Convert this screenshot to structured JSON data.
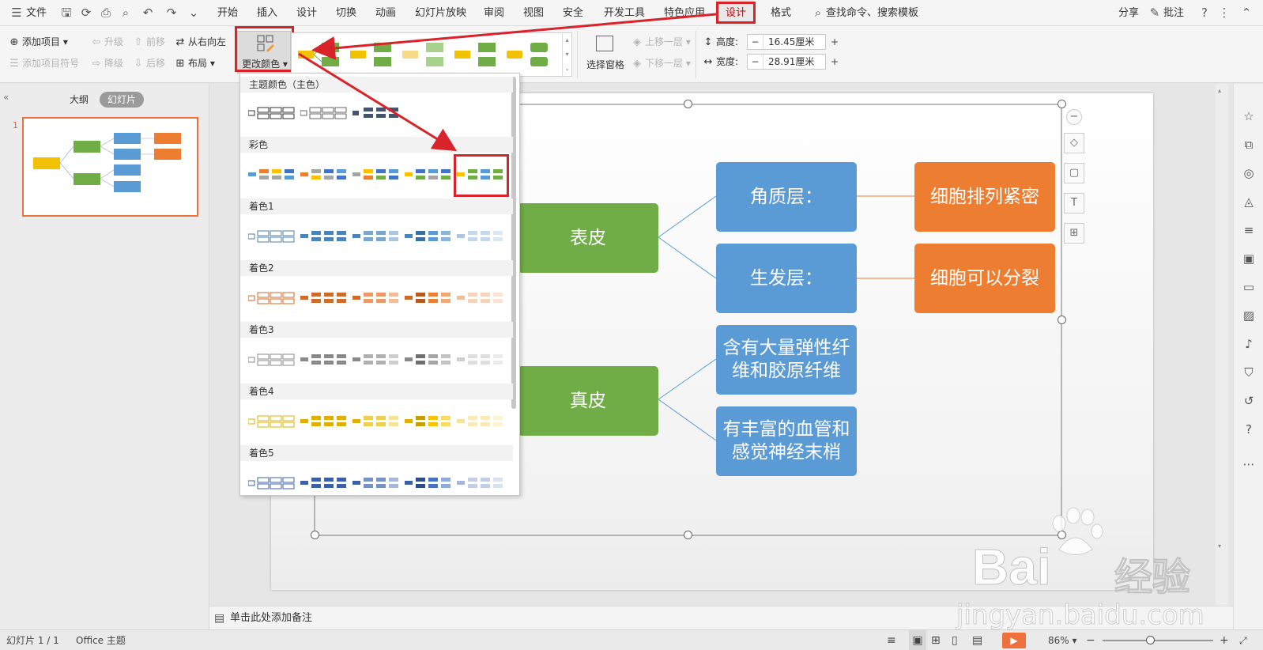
{
  "menubar": {
    "file_label": "文件",
    "tabs": [
      "开始",
      "插入",
      "设计",
      "切换",
      "动画",
      "幻灯片放映",
      "审阅",
      "视图",
      "安全",
      "开发工具",
      "特色应用",
      "设计",
      "格式"
    ],
    "search_label": "查找命令、搜索模板",
    "share_label": "分享",
    "comment_label": "批注"
  },
  "ribbon": {
    "add_item": "添加项目",
    "add_item_bullet": "添加项目符号",
    "promote": "升级",
    "demote": "降级",
    "move_forward": "前移",
    "move_backward": "后移",
    "right_to_left": "从右向左",
    "layout": "布局",
    "change_color": "更改颜色",
    "selection_pane": "选择窗格",
    "bring_forward": "上移一层",
    "send_backward": "下移一层",
    "height_label": "高度:",
    "height_value": "16.45厘米",
    "width_label": "宽度:",
    "width_value": "28.91厘米"
  },
  "leftpanel": {
    "outline_tab": "大纲",
    "slides_tab": "幻灯片",
    "slide_number": "1"
  },
  "dropdown": {
    "sections": [
      "主题颜色（主色）",
      "彩色",
      "着色1",
      "着色2",
      "着色3",
      "着色4",
      "着色5"
    ]
  },
  "diagram": {
    "level1": [
      "表皮",
      "真皮"
    ],
    "level2": [
      "角质层：",
      "生发层：",
      "含有大量弹性纤维和胶原纤维",
      "有丰富的血管和感觉神经末梢"
    ],
    "level3": [
      "细胞排列紧密",
      "细胞可以分裂"
    ],
    "colors": {
      "green": "#70ad47",
      "blue": "#5b9bd5",
      "orange": "#ed7d31"
    }
  },
  "notes_placeholder": "单击此处添加备注",
  "statusbar": {
    "slide_info": "幻灯片 1 / 1",
    "theme": "Office 主题",
    "zoom": "86%"
  },
  "watermark": {
    "brand": "Bai",
    "brand2": "经验",
    "url": "jingyan.baidu.com"
  },
  "icons": [
    "hamburger-icon",
    "save-icon",
    "undo-icon",
    "redo-icon",
    "print-icon",
    "preview-icon",
    "search-icon",
    "help-icon",
    "more-icon",
    "zoom-in-icon",
    "zoom-out-icon",
    "play-icon"
  ]
}
